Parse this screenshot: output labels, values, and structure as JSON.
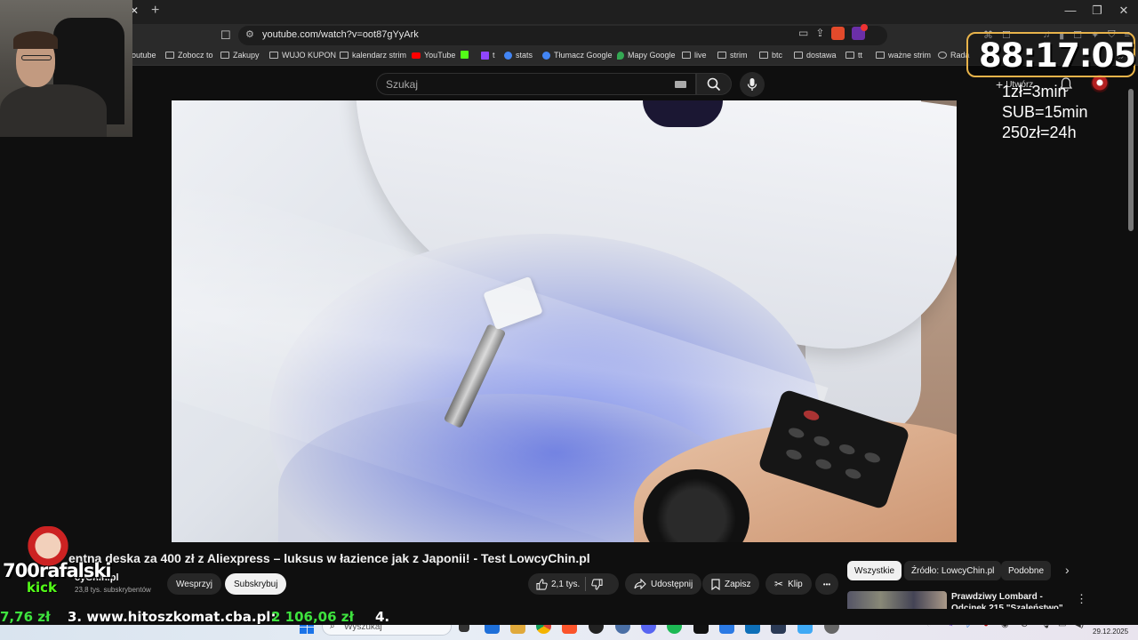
{
  "browser": {
    "tab_close": "✕",
    "tab_new": "+",
    "url": "youtube.com/watch?v=oot87gYyArk",
    "window_controls": [
      "—",
      "❐",
      "✕"
    ]
  },
  "bookmarks": {
    "items": [
      {
        "label": "outube",
        "icon": "folder-icon"
      },
      {
        "label": "Zobocz to",
        "icon": "folder-icon"
      },
      {
        "label": "Zakupy",
        "icon": "folder-icon"
      },
      {
        "label": "WUJO KUPON",
        "icon": "folder-icon"
      },
      {
        "label": "kalendarz strim",
        "icon": "folder-icon"
      },
      {
        "label": "YouTube",
        "icon": "youtube-icon"
      },
      {
        "label": "",
        "icon": "kick-icon"
      },
      {
        "label": "t",
        "icon": "twitch-icon"
      },
      {
        "label": "stats",
        "icon": "stats-icon"
      },
      {
        "label": "Tłumacz Google",
        "icon": "translate-icon"
      },
      {
        "label": "Mapy Google",
        "icon": "maps-icon"
      },
      {
        "label": "live",
        "icon": "folder-icon"
      },
      {
        "label": "strim",
        "icon": "folder-icon"
      },
      {
        "label": "btc",
        "icon": "folder-icon"
      },
      {
        "label": "dostawa",
        "icon": "folder-icon"
      },
      {
        "label": "tt",
        "icon": "folder-icon"
      },
      {
        "label": "ważne strim",
        "icon": "folder-icon"
      },
      {
        "label": "Rada",
        "icon": "drop-icon"
      }
    ],
    "more": "»"
  },
  "youtube": {
    "search_placeholder": "Szukaj",
    "create_label": "Utwórz",
    "video": {
      "title": "entna deska za 400 zł z Aliexpress – luksus w łazience jak z Japonii! - Test LowcyChin.pl",
      "channel": "cyChin.pl",
      "subscribers": "23,8 tys. subskrybentów",
      "support_label": "Wesprzyj",
      "subscribe_label": "Subskrybuj",
      "likes": "2,1 tys.",
      "share_label": "Udostępnij",
      "save_label": "Zapisz",
      "clip_label": "Klip",
      "more_label": "•••"
    },
    "chips": [
      {
        "label": "Wszystkie",
        "active": true
      },
      {
        "label": "Źródło: LowcyChin.pl",
        "active": false
      },
      {
        "label": "Podobne",
        "active": false
      }
    ],
    "chips_next": "›",
    "recommended": {
      "title": "Prawdziwy Lombard - Odcinek 215 \"Szaleństwo\""
    }
  },
  "overlay": {
    "timer": "88:17:05",
    "rules": [
      "1zł=3min",
      "SUB=15min",
      "250zł=24h"
    ],
    "kick_name": "700rafalski",
    "kick_brand": "kick"
  },
  "ticker": {
    "amount_left": "7,76 zł",
    "site": "3. www.hitoszkomat.cba.pl:",
    "amount": "2 106,06 zł",
    "next": "4."
  },
  "taskbar": {
    "search_placeholder": "Wyszukaj",
    "time": "11:43",
    "date": "29.12.2025"
  }
}
